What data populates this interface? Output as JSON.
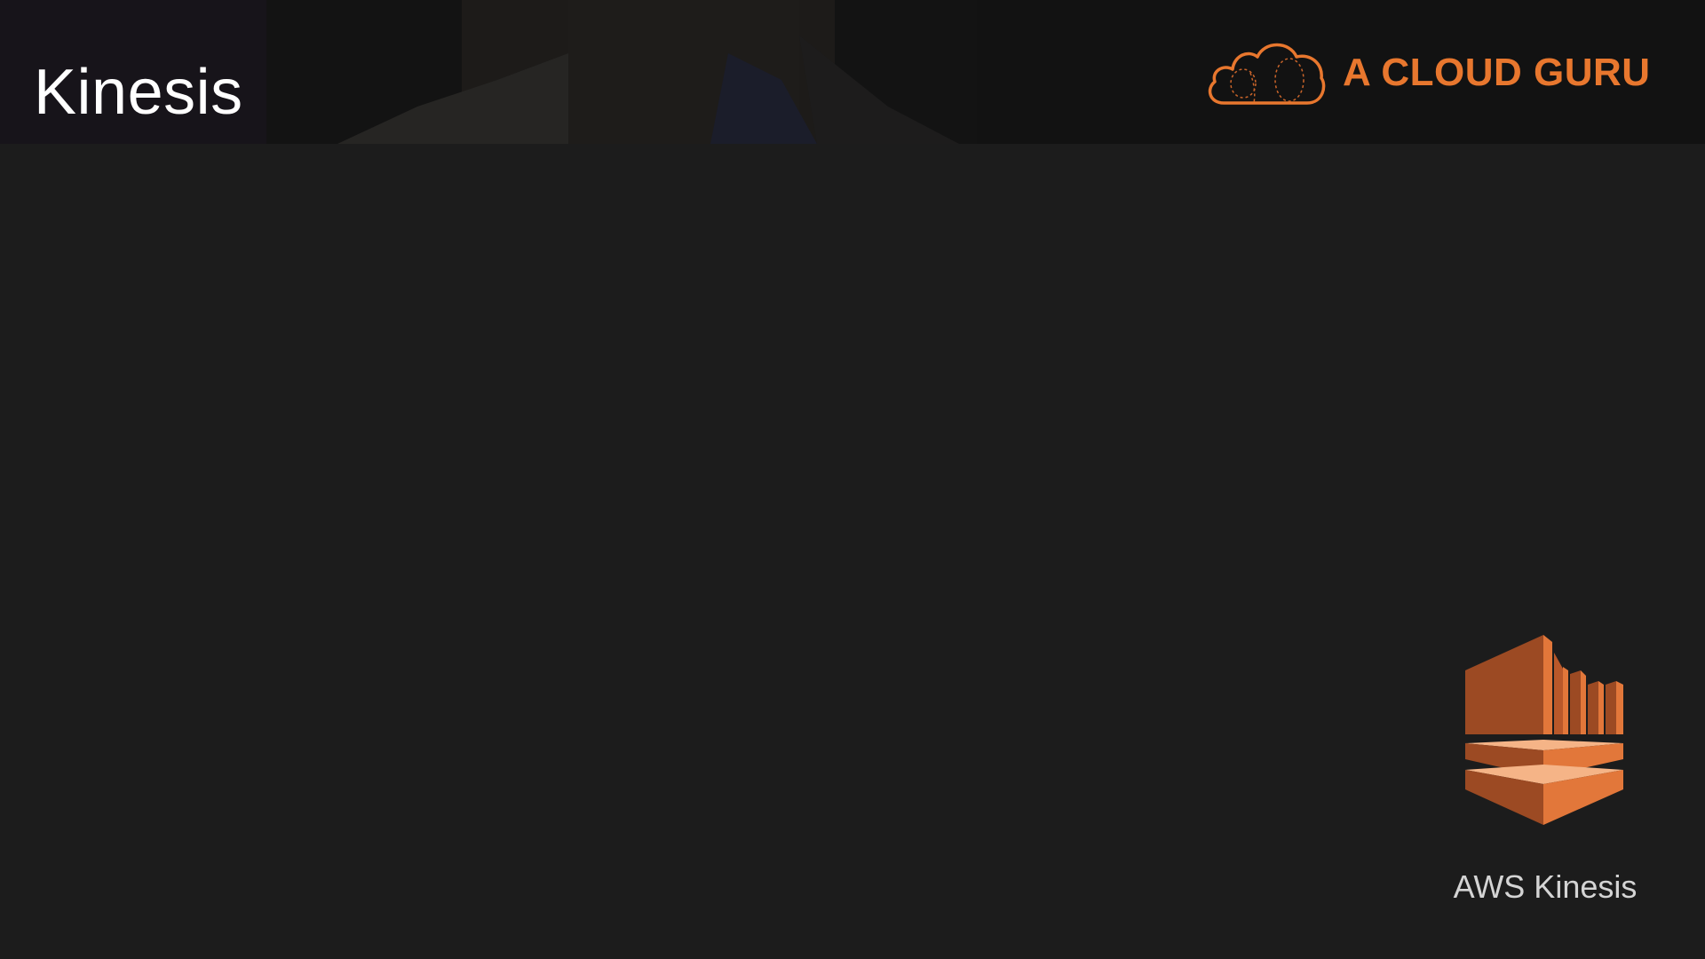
{
  "slide": {
    "title": "Kinesis",
    "brand": {
      "name": "A CLOUD GURU",
      "icon": "cloud-logo-icon",
      "color": "#e8772e"
    },
    "service": {
      "icon": "aws-kinesis-icon",
      "caption": "AWS Kinesis",
      "colors": {
        "dark": "#9c4a23",
        "mid": "#e2773a",
        "light": "#f5b487"
      }
    },
    "background": "#1c1c1c"
  }
}
